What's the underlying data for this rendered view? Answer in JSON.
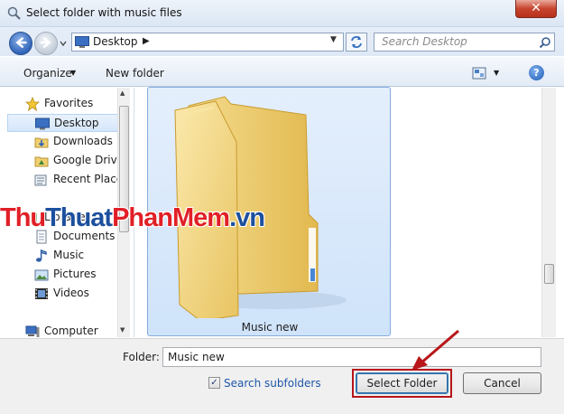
{
  "window": {
    "title": "Select folder with music files",
    "close_label": "✕"
  },
  "address": {
    "location": "Desktop",
    "search_placeholder": "Search Desktop"
  },
  "toolbar": {
    "organize_label": "Organize",
    "new_folder_label": "New folder",
    "help_label": "?"
  },
  "nav": {
    "favorites": "Favorites",
    "items": [
      {
        "label": "Desktop",
        "icon": "desktop-icon"
      },
      {
        "label": "Downloads",
        "icon": "downloads-icon"
      },
      {
        "label": "Google Drive",
        "icon": "google-drive-icon"
      },
      {
        "label": "Recent Places",
        "icon": "recent-places-icon"
      },
      {
        "label": "Libraries",
        "icon": "libraries-icon"
      },
      {
        "label": "Documents",
        "icon": "documents-icon"
      },
      {
        "label": "Music",
        "icon": "music-icon"
      },
      {
        "label": "Pictures",
        "icon": "pictures-icon"
      },
      {
        "label": "Videos",
        "icon": "videos-icon"
      }
    ],
    "computer": "Computer"
  },
  "content": {
    "folder_name": "Music new"
  },
  "bottom": {
    "folder_label": "Folder:",
    "folder_value": "Music new",
    "search_subfolders_label": "Search subfolders",
    "search_subfolders_checked": true,
    "select_button": "Select Folder",
    "cancel_button": "Cancel"
  },
  "watermark": {
    "part1": "Thu",
    "part2": "Thuat",
    "part3": "PhanMem",
    "part4": ".vn"
  },
  "colors": {
    "highlight_red": "#b8161a",
    "selection_blue": "#cfe3fa",
    "folder_yellow": "#f3d27a"
  }
}
